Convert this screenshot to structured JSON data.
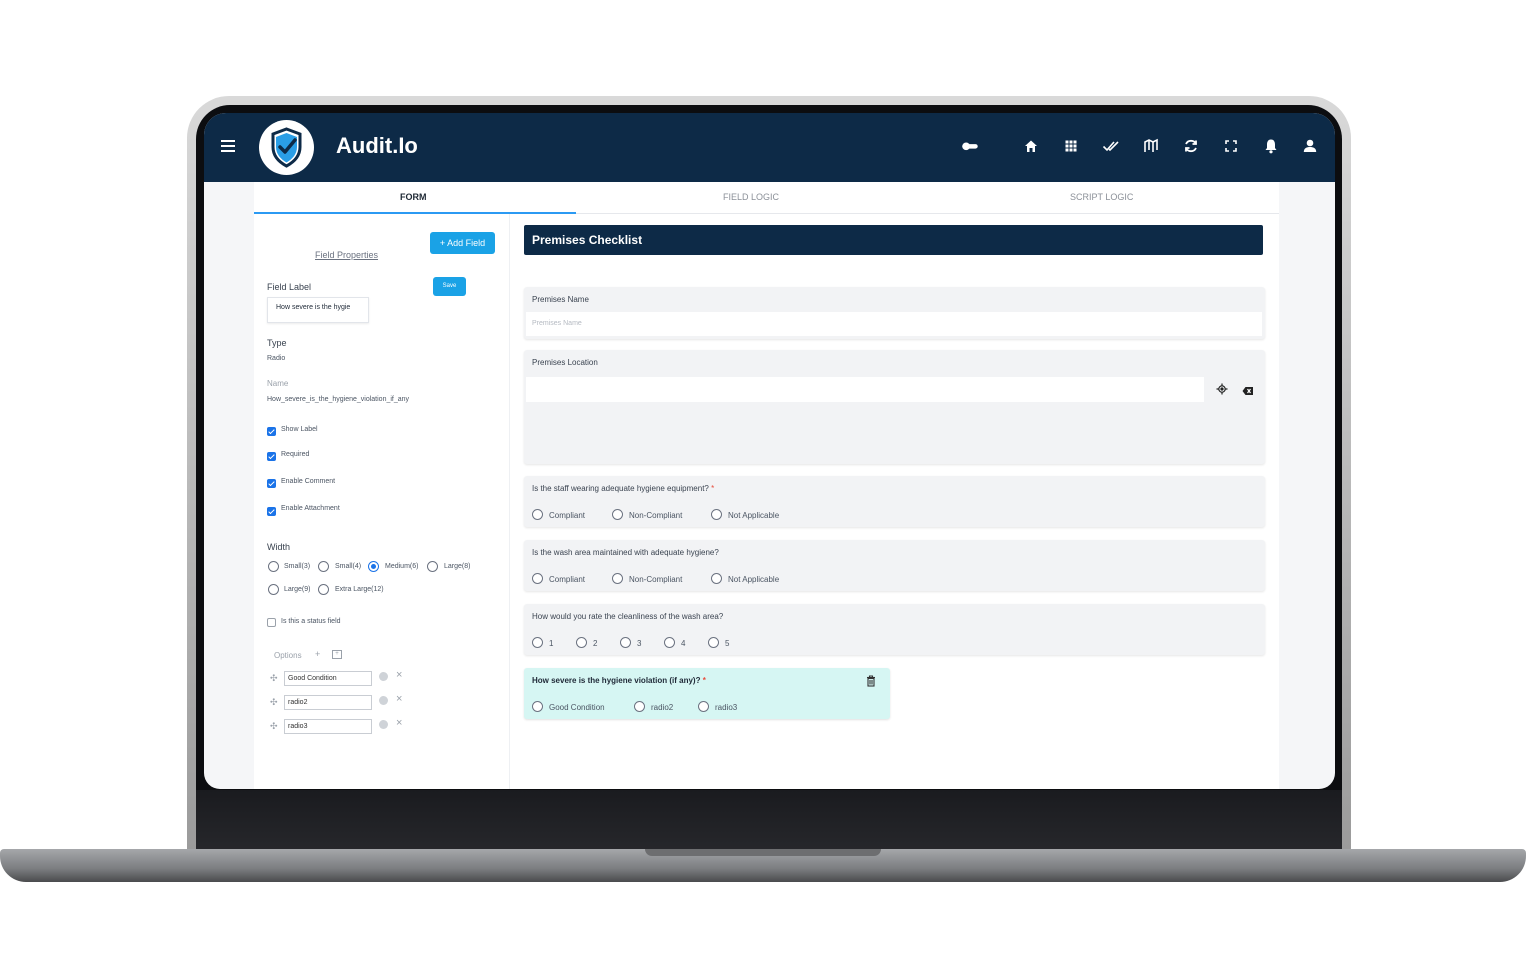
{
  "app": {
    "title": "Audit.Io"
  },
  "topbar": {
    "icons": [
      "toggle-icon",
      "home-icon",
      "apps-grid-icon",
      "double-check-icon",
      "map-icon",
      "sync-icon",
      "fullscreen-icon",
      "bell-icon",
      "user-icon"
    ]
  },
  "tabs": [
    {
      "label": "FORM",
      "active": true
    },
    {
      "label": "FIELD LOGIC",
      "active": false
    },
    {
      "label": "SCRIPT LOGIC",
      "active": false
    }
  ],
  "field_properties": {
    "add_field_label": "+ Add Field",
    "heading": "Field Properties",
    "field_label_caption": "Field Label",
    "save_label": "Save",
    "field_label_value": "How severe is the hygie",
    "type_caption": "Type",
    "type_value": "Radio",
    "name_caption": "Name",
    "name_value": "How_severe_is_the_hygiene_violation_if_any",
    "checkboxes": [
      {
        "label": "Show Label",
        "checked": true
      },
      {
        "label": "Required",
        "checked": true
      },
      {
        "label": "Enable Comment",
        "checked": true
      },
      {
        "label": "Enable Attachment",
        "checked": true
      }
    ],
    "width_caption": "Width",
    "width_options": [
      {
        "label": "Small(3)",
        "selected": false
      },
      {
        "label": "Small(4)",
        "selected": false
      },
      {
        "label": "Medium(6)",
        "selected": true
      },
      {
        "label": "Large(8)",
        "selected": false
      },
      {
        "label": "Large(9)",
        "selected": false
      },
      {
        "label": "Extra Large(12)",
        "selected": false
      }
    ],
    "status_field_label": "Is this a status field",
    "options_caption": "Options",
    "options": [
      "Good Condition",
      "radio2",
      "radio3"
    ]
  },
  "form": {
    "title": "Premises Checklist",
    "premises_name": {
      "label": "Premises Name",
      "placeholder": "Premises Name"
    },
    "premises_location": {
      "label": "Premises Location"
    },
    "q1": {
      "text": "Is the staff wearing adequate hygiene equipment?",
      "required_mark": "*",
      "options": [
        "Compliant",
        "Non-Compliant",
        "Not Applicable"
      ]
    },
    "q2": {
      "text": "Is the wash area maintained with adequate hygiene?",
      "options": [
        "Compliant",
        "Non-Compliant",
        "Not Applicable"
      ]
    },
    "q3": {
      "text": "How would you rate the cleanliness of the wash area?",
      "options": [
        "1",
        "2",
        "3",
        "4",
        "5"
      ]
    },
    "q4": {
      "text": "How severe is the hygiene violation (if any)?",
      "required_mark": "*",
      "options": [
        "Good Condition",
        "radio2",
        "radio3"
      ]
    }
  },
  "colors": {
    "appbar": "#0d2a47",
    "accent": "#1aa2e6",
    "highlight_card": "#d6f6f3"
  }
}
